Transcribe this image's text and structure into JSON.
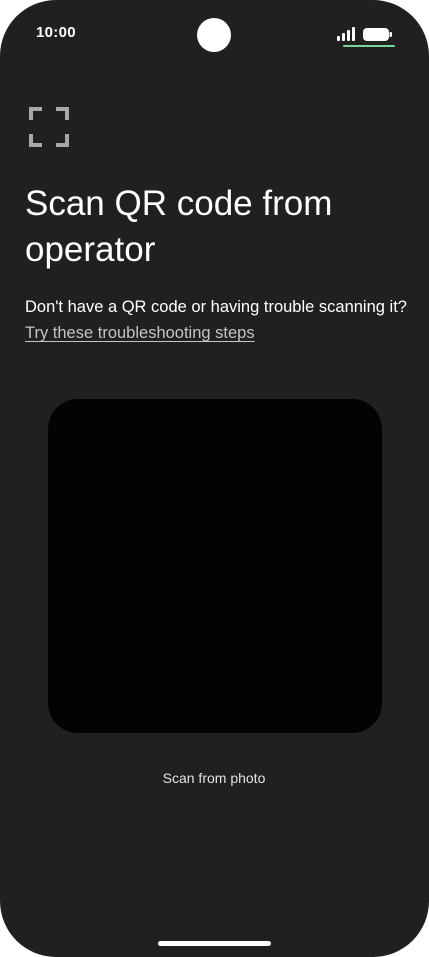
{
  "status_bar": {
    "time": "10:00"
  },
  "screen": {
    "title": "Scan QR code from operator",
    "help_text": "Don't have a QR code or having trouble scanning it? ",
    "help_link": "Try these troubleshooting steps",
    "scan_from_photo_label": "Scan from photo"
  },
  "icons": {
    "qr_scan": "qr-scan-frame-icon",
    "signal": "cellular-signal-icon",
    "battery": "battery-icon"
  },
  "colors": {
    "background": "#202020",
    "viewfinder": "#030303",
    "text": "#ffffff",
    "link": "#c4c4c4",
    "icon": "#a8a8a8",
    "battery_indicator": "#7ed39b"
  }
}
